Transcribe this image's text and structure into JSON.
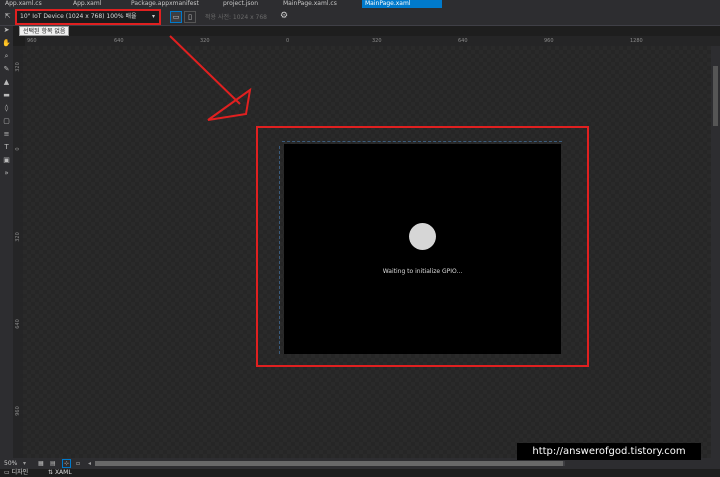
{
  "tabs": [
    {
      "label": "App.xaml.cs",
      "active": false
    },
    {
      "label": "App.xaml",
      "active": false
    },
    {
      "label": "Package.appxmanifest",
      "active": false
    },
    {
      "label": "project.json",
      "active": false
    },
    {
      "label": "MainPage.xaml.cs",
      "active": false
    },
    {
      "label": "MainPage.xaml",
      "active": true
    }
  ],
  "toolbar": {
    "device_label": "10\" IoT Device (1024 x 768) 100% 배율",
    "effective_size": "적용 사전: 1024 x 768",
    "tooltip": "선택된 항목 없음"
  },
  "ruler_top": [
    "960",
    "640",
    "320",
    "0",
    "320",
    "640",
    "960",
    "1280"
  ],
  "ruler_left": [
    "320",
    "0",
    "320",
    "640",
    "960"
  ],
  "device": {
    "status_text": "Waiting to initialize GPIO..."
  },
  "bottom": {
    "zoom": "50%",
    "design_tab": "디자인",
    "xaml_tab": "XAML"
  },
  "watermark": "http://answerofgod.tistory.com",
  "colors": {
    "accent": "#007acc",
    "highlight_red": "#e02020",
    "background": "#1e1e1e"
  }
}
